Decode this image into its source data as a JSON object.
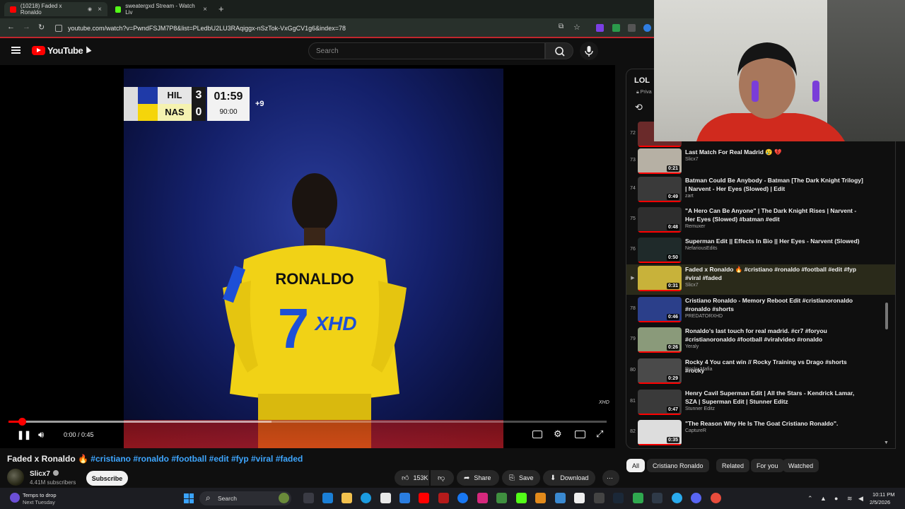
{
  "browser": {
    "tabs": [
      {
        "label": "(10218) Faded x Ronaldo",
        "favicon_color": "#ff0000",
        "active": true
      },
      {
        "label": "sweatergxd Stream - Watch Liv",
        "favicon_color": "#53fc18",
        "active": false
      }
    ],
    "new_tab": "+",
    "url": "youtube.com/watch?v=PwndFSJM7P8&list=PLedbU2LU3RAqiggx-nSzTok-VxGgCV1g6&index=78"
  },
  "header": {
    "logo_text": "YouTube",
    "search_placeholder": "Search"
  },
  "player": {
    "scoreboard": {
      "team1": "HIL",
      "team2": "NAS",
      "score1": "3",
      "score2": "0",
      "clock": "01:59",
      "period": "90:00",
      "stoppage": "+9"
    },
    "jersey_name": "RONALDO",
    "jersey_number": "7",
    "jersey_text": "XHD",
    "watermark": "XHD",
    "time": "0:00 / 0:45",
    "progress_played": 0.022,
    "progress_buffered": 0.44
  },
  "video": {
    "title": "Faded x Ronaldo 🔥",
    "hashtags": "#cristiano #ronaldo #football #edit #fyp #viral #faded",
    "channel": "Slicx7",
    "subscribers": "4.41M subscribers",
    "subscribe_label": "Subscribe",
    "likes": "153K",
    "share_label": "Share",
    "save_label": "Save",
    "download_label": "Download"
  },
  "playlist": {
    "title": "LOL",
    "privacy": "Priva",
    "items": [
      {
        "index": "72",
        "title": "",
        "channel": "",
        "duration": ""
      },
      {
        "index": "73",
        "title": "Last Match For Real Madrid 😢 💔",
        "channel": "Slicx7",
        "duration": "0:21"
      },
      {
        "index": "74",
        "title": "Batman Could Be Anybody - Batman [The Dark Knight Trilogy] | Narvent - Her Eyes (Slowed) | Edit",
        "channel": "zart",
        "duration": "0:49"
      },
      {
        "index": "75",
        "title": "\"A Hero Can Be Anyone\" | The Dark Knight Rises | Narvent - Her Eyes (Slowed) #batman #edit",
        "channel": "Remuxer",
        "duration": "0:48"
      },
      {
        "index": "76",
        "title": "Superman Edit || Effects In Bio || Her Eyes - Narvent (Slowed)",
        "channel": "NefariousEdits",
        "duration": "0:50"
      },
      {
        "index": "▶",
        "title": "Faded x Ronaldo 🔥 #cristiano #ronaldo #football #edit #fyp #viral #faded",
        "channel": "Slicx7",
        "duration": "0:31"
      },
      {
        "index": "78",
        "title": "Cristiano Ronaldo - Memory Reboot Edit #cristianoronaldo #ronaldo #shorts",
        "channel": "PREDATORXHD",
        "duration": "0:46"
      },
      {
        "index": "79",
        "title": "Ronaldo's last touch for real madrid. #cr7 #foryou #cristianoronaldo #football #viralvideo #ronaldo",
        "channel": "Yeraly",
        "duration": "0:26"
      },
      {
        "index": "80",
        "title": "Rocky 4 You cant win // Rocky Training vs Drago #shorts #rocky",
        "channel": "Rocky Mafia",
        "duration": "0:29"
      },
      {
        "index": "81",
        "title": "Henry Cavil Superman Edit | All the Stars - Kendrick Lamar, SZA | Superman Edit | Stunner Editz",
        "channel": "Stunner Editz",
        "duration": "0:47"
      },
      {
        "index": "82",
        "title": "\"The Reason Why He Is The Goat Cristiano Ronaldo\".",
        "channel": "CaptureR",
        "duration": "0:35"
      }
    ]
  },
  "chips": [
    "All",
    "Cristiano Ronaldo",
    "Related",
    "For you",
    "Watched"
  ],
  "taskbar": {
    "weather_line1": "Temps to drop",
    "weather_line2": "Next Tuesday",
    "search_label": "Search",
    "time": "10:11 PM",
    "date": "2/5/2026"
  }
}
